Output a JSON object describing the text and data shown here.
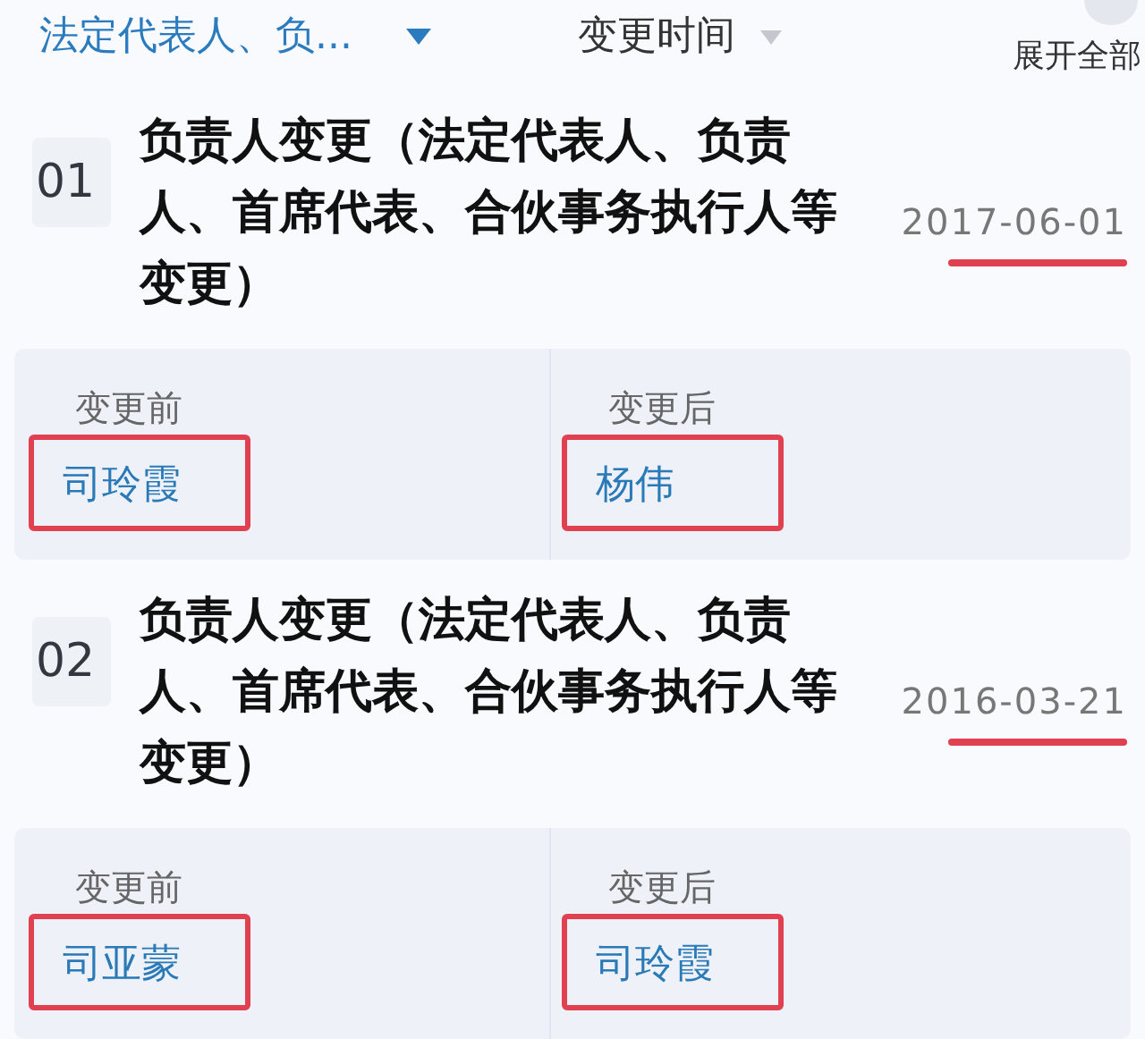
{
  "filter": {
    "label": "法定代表人、负..."
  },
  "sort": {
    "label": "变更时间"
  },
  "expand_all": {
    "label": "展开全部"
  },
  "records": [
    {
      "index": "01",
      "title": "负责人变更（法定代表人、负责人、首席代表、合伙事务执行人等变更）",
      "date": "2017-06-01",
      "date_highlighted": true,
      "before_label": "变更前",
      "before": "司玲霞",
      "before_highlighted": true,
      "after_label": "变更后",
      "after": "杨伟",
      "after_highlighted": true
    },
    {
      "index": "02",
      "title": "负责人变更（法定代表人、负责人、首席代表、合伙事务执行人等变更）",
      "date": "2016-03-21",
      "date_highlighted": true,
      "before_label": "变更前",
      "before": "司亚蒙",
      "before_highlighted": true,
      "after_label": "变更后",
      "after": "司玲霞",
      "after_highlighted": true
    }
  ]
}
